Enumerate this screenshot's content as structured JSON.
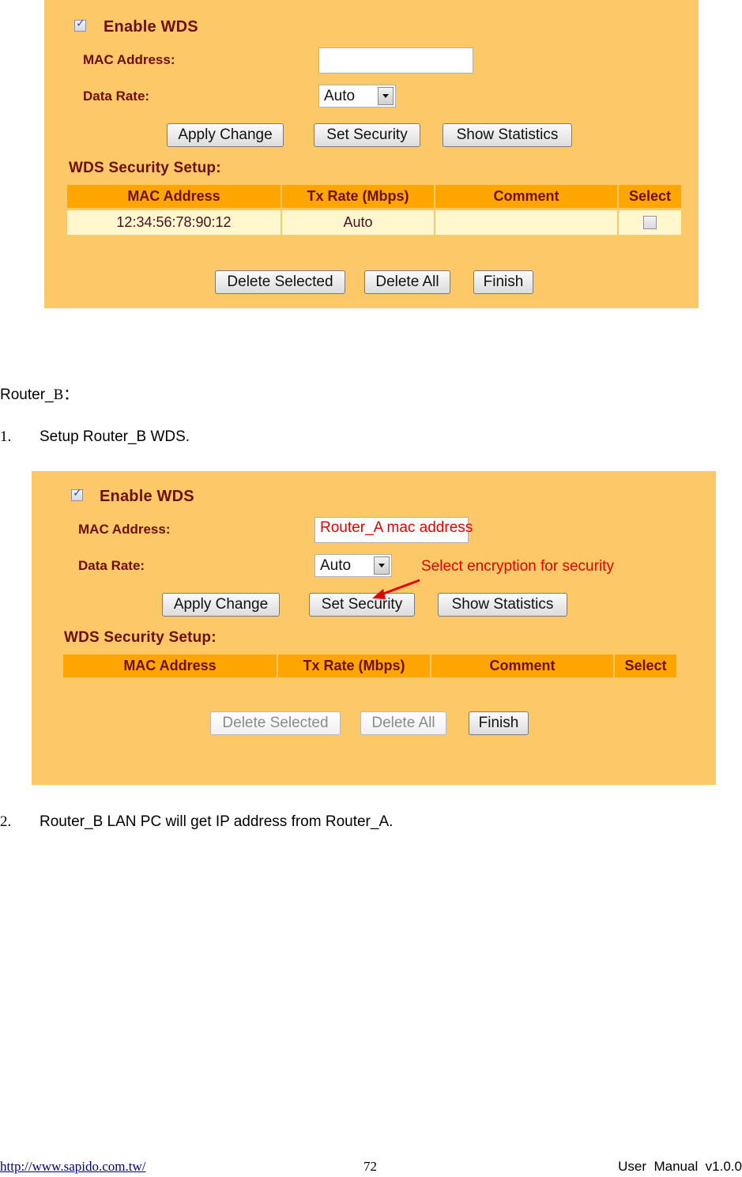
{
  "panel_a": {
    "enable_wds_label": "Enable WDS",
    "enable_wds_checked": true,
    "mac_address_label": "MAC Address:",
    "mac_address_value": "",
    "data_rate_label": "Data Rate:",
    "data_rate_value": "Auto",
    "buttons": {
      "apply_change": "Apply Change",
      "set_security": "Set Security",
      "show_statistics": "Show Statistics",
      "delete_selected": "Delete Selected",
      "delete_all": "Delete All",
      "finish": "Finish"
    },
    "security_setup_title": "WDS Security Setup:",
    "table": {
      "columns": [
        "MAC Address",
        "Tx Rate (Mbps)",
        "Comment",
        "Select"
      ],
      "rows": [
        {
          "mac": "12:34:56:78:90:12",
          "tx_rate": "Auto",
          "comment": "",
          "selected": false
        }
      ]
    }
  },
  "doc": {
    "router_b_heading": "Router_",
    "router_b_letter": "B",
    "router_b_colon": "：",
    "step1_number": "1.",
    "step1_text": "Setup Router_B WDS.",
    "step2_number": "2.",
    "step2_text": "Router_B LAN PC will get IP address from Router_A."
  },
  "panel_b": {
    "enable_wds_label": "Enable WDS",
    "enable_wds_checked": true,
    "mac_address_label": "MAC Address:",
    "mac_address_annotation": "Router_A mac address",
    "data_rate_label": "Data Rate:",
    "data_rate_value": "Auto",
    "security_annotation": "Select encryption for security",
    "annotation_color": "#e00000",
    "buttons": {
      "apply_change": "Apply Change",
      "set_security": "Set Security",
      "show_statistics": "Show Statistics",
      "delete_selected": "Delete Selected",
      "delete_all": "Delete All",
      "finish": "Finish"
    },
    "security_setup_title": "WDS Security Setup:",
    "table": {
      "columns": [
        "MAC Address",
        "Tx Rate (Mbps)",
        "Comment",
        "Select"
      ],
      "rows": []
    }
  },
  "footer": {
    "url": "http://www.sapido.com.tw/",
    "page_number": "72",
    "manual_version": "User  Manual  v1.0.0"
  }
}
